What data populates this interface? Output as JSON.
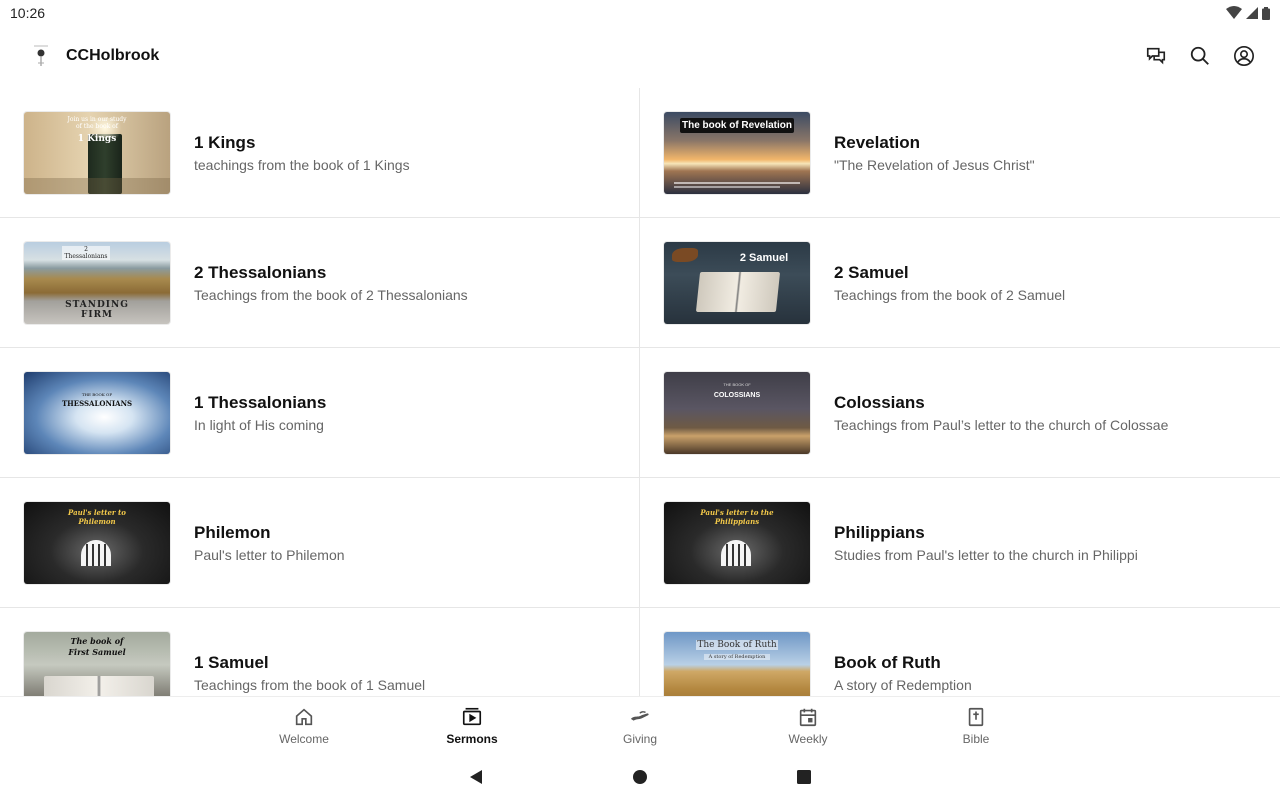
{
  "status_bar": {
    "time": "10:26"
  },
  "app_bar": {
    "title": "CCHolbrook",
    "actions": [
      "chat-icon",
      "search-icon",
      "account-icon"
    ]
  },
  "sermons": [
    {
      "title": "1 Kings",
      "subtitle": "teachings from the book of 1 Kings",
      "thumb_text": "Join us in our study of the book of",
      "thumb_title": "1 Kings"
    },
    {
      "title": "Revelation",
      "subtitle": "\"The Revelation of Jesus Christ\"",
      "thumb_text": "The book of Revelation"
    },
    {
      "title": "2 Thessalonians",
      "subtitle": "Teachings from the book of 2 Thessalonians",
      "thumb_text": "2 Thessalonians",
      "thumb_title": "STANDING FIRM"
    },
    {
      "title": "2 Samuel",
      "subtitle": "Teachings from the book of 2 Samuel",
      "thumb_text": "2 Samuel"
    },
    {
      "title": "1 Thessalonians",
      "subtitle": "In light of His coming",
      "thumb_text": "THE BOOK OF",
      "thumb_title": "THESSALONIANS"
    },
    {
      "title": "Colossians",
      "subtitle": "Teachings from Paul’s letter to the church of Colossae",
      "thumb_text": "THE BOOK OF",
      "thumb_title": "COLOSSIANS"
    },
    {
      "title": "Philemon",
      "subtitle": "Paul's letter to Philemon",
      "thumb_text": "Paul's letter to Philemon"
    },
    {
      "title": "Philippians",
      "subtitle": "Studies from Paul's letter to the church in Philippi",
      "thumb_text": "Paul's letter to the Philippians"
    },
    {
      "title": "1 Samuel",
      "subtitle": "Teachings from the book of 1 Samuel",
      "thumb_text": "The book of First Samuel"
    },
    {
      "title": "Book of Ruth",
      "subtitle": "A story of Redemption",
      "thumb_text": "The Book of Ruth",
      "thumb_title": "A story of Redemption"
    }
  ],
  "bottom_nav": [
    {
      "label": "Welcome",
      "icon": "home-icon",
      "active": false
    },
    {
      "label": "Sermons",
      "icon": "video-icon",
      "active": true
    },
    {
      "label": "Giving",
      "icon": "giving-icon",
      "active": false
    },
    {
      "label": "Weekly",
      "icon": "calendar-icon",
      "active": false
    },
    {
      "label": "Bible",
      "icon": "bible-icon",
      "active": false
    }
  ]
}
